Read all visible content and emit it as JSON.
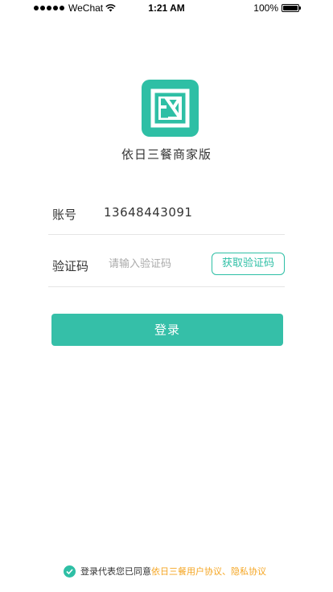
{
  "status_bar": {
    "carrier": "WeChat",
    "time": "1:21 AM",
    "battery": "100%"
  },
  "app": {
    "name": "依日三餐商家版"
  },
  "form": {
    "account_label": "账号",
    "account_value": "13648443091",
    "code_label": "验证码",
    "code_placeholder": "请输入验证码",
    "get_code_label": "获取验证码",
    "login_label": "登录"
  },
  "agreement": {
    "text": "登录代表您已同意",
    "link_text": "依日三餐用户协议、隐私协议"
  },
  "colors": {
    "accent": "#2ebfa5",
    "link": "#f5a623"
  }
}
